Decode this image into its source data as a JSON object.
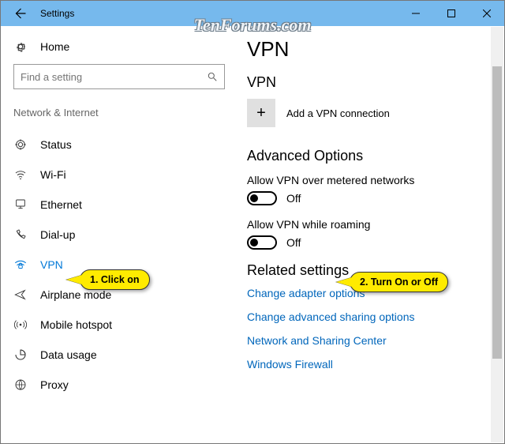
{
  "titlebar": {
    "title": "Settings"
  },
  "watermark": "TenForums.com",
  "sidebar": {
    "home": "Home",
    "search_placeholder": "Find a setting",
    "group": "Network & Internet",
    "items": [
      {
        "label": "Status"
      },
      {
        "label": "Wi-Fi"
      },
      {
        "label": "Ethernet"
      },
      {
        "label": "Dial-up"
      },
      {
        "label": "VPN"
      },
      {
        "label": "Airplane mode"
      },
      {
        "label": "Mobile hotspot"
      },
      {
        "label": "Data usage"
      },
      {
        "label": "Proxy"
      }
    ]
  },
  "main": {
    "page_title": "VPN",
    "section_title": "VPN",
    "add_label": "Add a VPN connection",
    "advanced_title": "Advanced Options",
    "opt1_label": "Allow VPN over metered networks",
    "opt1_state": "Off",
    "opt2_label": "Allow VPN while roaming",
    "opt2_state": "Off",
    "related_title": "Related settings",
    "links": [
      "Change adapter options",
      "Change advanced sharing options",
      "Network and Sharing Center",
      "Windows Firewall"
    ]
  },
  "callouts": {
    "one": "1. Click on",
    "two": "2. Turn On or Off"
  }
}
